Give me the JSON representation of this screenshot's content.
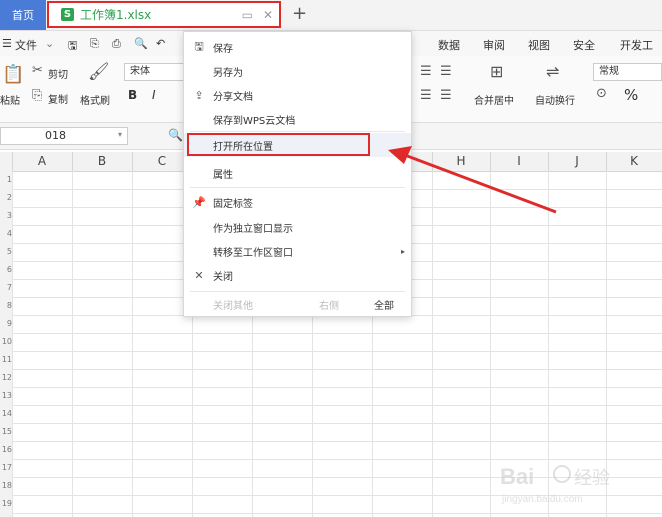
{
  "tabs": {
    "home": "首页",
    "doc_badge": "S",
    "doc_name": "工作簿1.xlsx",
    "new_tab": "+"
  },
  "menu": {
    "file": "文件",
    "right_items": [
      "数据",
      "审阅",
      "视图",
      "安全",
      "开发工具"
    ]
  },
  "ribbon": {
    "paste": "粘贴",
    "cut": "剪切",
    "copy": "复制",
    "format_painter": "格式刷",
    "font_name": "宋体",
    "bold": "B",
    "italic": "I",
    "merge_center": "合并居中",
    "wrap_text": "自动换行",
    "number_format": "常规",
    "percent": "%"
  },
  "formula": {
    "name_box": "018"
  },
  "columns": [
    "A",
    "B",
    "C",
    "D",
    "E",
    "F",
    "G",
    "H",
    "I",
    "J",
    "K"
  ],
  "rows": [
    "1",
    "2",
    "3",
    "4",
    "5",
    "6",
    "7",
    "8",
    "9",
    "10",
    "11",
    "12",
    "13",
    "14",
    "15",
    "16",
    "17",
    "18",
    "19"
  ],
  "context_menu": {
    "items": [
      {
        "icon": "save-icon",
        "label": "保存"
      },
      {
        "icon": "",
        "label": "另存为"
      },
      {
        "icon": "share-icon",
        "label": "分享文档"
      },
      {
        "icon": "",
        "label": "保存到WPS云文档"
      },
      {
        "icon": "",
        "label": "打开所在位置"
      },
      {
        "icon": "",
        "label": "属性"
      },
      {
        "icon": "pin-icon",
        "label": "固定标签"
      },
      {
        "icon": "",
        "label": "作为独立窗口显示"
      },
      {
        "icon": "",
        "label": "转移至工作区窗口"
      },
      {
        "icon": "close-icon",
        "label": "关闭"
      }
    ],
    "footer": {
      "close_others": "关闭其他",
      "right": "右侧",
      "all": "全部"
    }
  },
  "colors": {
    "accent_blue": "#4a7bd6",
    "green": "#2da44e",
    "annotation_red": "#e02a2a"
  }
}
